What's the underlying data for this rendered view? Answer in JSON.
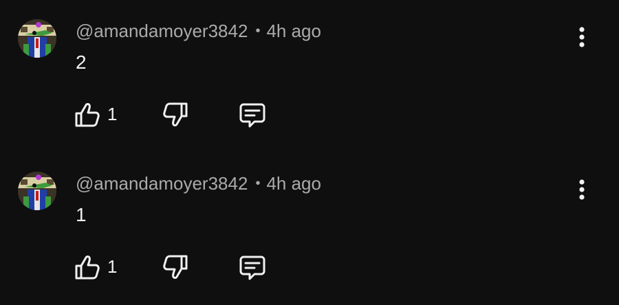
{
  "comments": [
    {
      "author": "@amandamoyer3842",
      "separator": "•",
      "time": "4h ago",
      "text": "2",
      "likes": "1",
      "icons": {
        "like": "thumbs-up-icon",
        "dislike": "thumbs-down-icon",
        "reply": "reply-icon",
        "more": "more-vertical-icon"
      }
    },
    {
      "author": "@amandamoyer3842",
      "separator": "•",
      "time": "4h ago",
      "text": "1",
      "likes": "1",
      "icons": {
        "like": "thumbs-up-icon",
        "dislike": "thumbs-down-icon",
        "reply": "reply-icon",
        "more": "more-vertical-icon"
      }
    }
  ],
  "colors": {
    "background": "#0f0f0f",
    "primary_text": "#f1f1f1",
    "secondary_text": "#aaaaaa"
  }
}
